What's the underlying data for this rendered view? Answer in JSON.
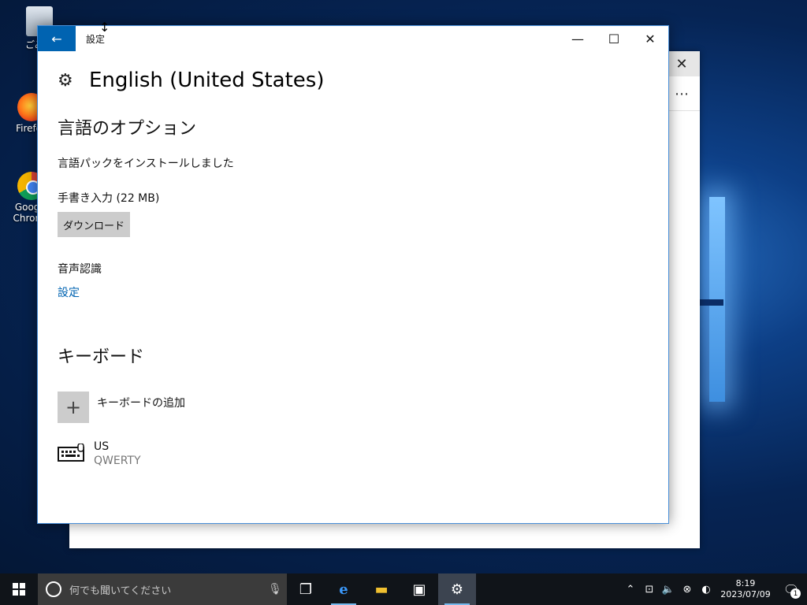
{
  "desktop": {
    "icons": [
      {
        "label": "ごみ箱",
        "name": "recycle-bin"
      },
      {
        "label": "Firefox",
        "name": "firefox"
      },
      {
        "label": "Google Chrome",
        "name": "google-chrome"
      }
    ]
  },
  "background_window": {
    "close_glyph": "✕",
    "more_glyph": "⋯"
  },
  "settings_window": {
    "title": "設定",
    "back_glyph": "←",
    "controls": {
      "minimize": "—",
      "maximize": "☐",
      "close": "✕"
    },
    "page_icon": "gear-icon",
    "page_title": "English (United States)",
    "language_options_heading": "言語のオプション",
    "language_pack_status": "言語パックをインストールしました",
    "handwriting_label": "手書き入力 (22 MB)",
    "download_button": "ダウンロード",
    "speech_label": "音声認識",
    "speech_settings_link": "設定",
    "keyboard_heading": "キーボード",
    "add_keyboard_label": "キーボードの追加",
    "add_keyboard_glyph": "+",
    "keyboards": [
      {
        "name": "US",
        "layout": "QWERTY"
      }
    ]
  },
  "taskbar": {
    "search_placeholder": "何でも聞いてください",
    "apps": [
      {
        "name": "task-view",
        "glyph": "❐"
      },
      {
        "name": "edge",
        "glyph": "e"
      },
      {
        "name": "file-explorer",
        "glyph": "▬"
      },
      {
        "name": "store",
        "glyph": "▣"
      },
      {
        "name": "settings",
        "glyph": "⚙"
      }
    ],
    "tray": {
      "time": "8:19",
      "date": "2023/07/09",
      "notification_count": "1"
    }
  },
  "colors": {
    "accent": "#0063b1",
    "taskbar": "#101419",
    "search_box": "#3b3b3b"
  }
}
